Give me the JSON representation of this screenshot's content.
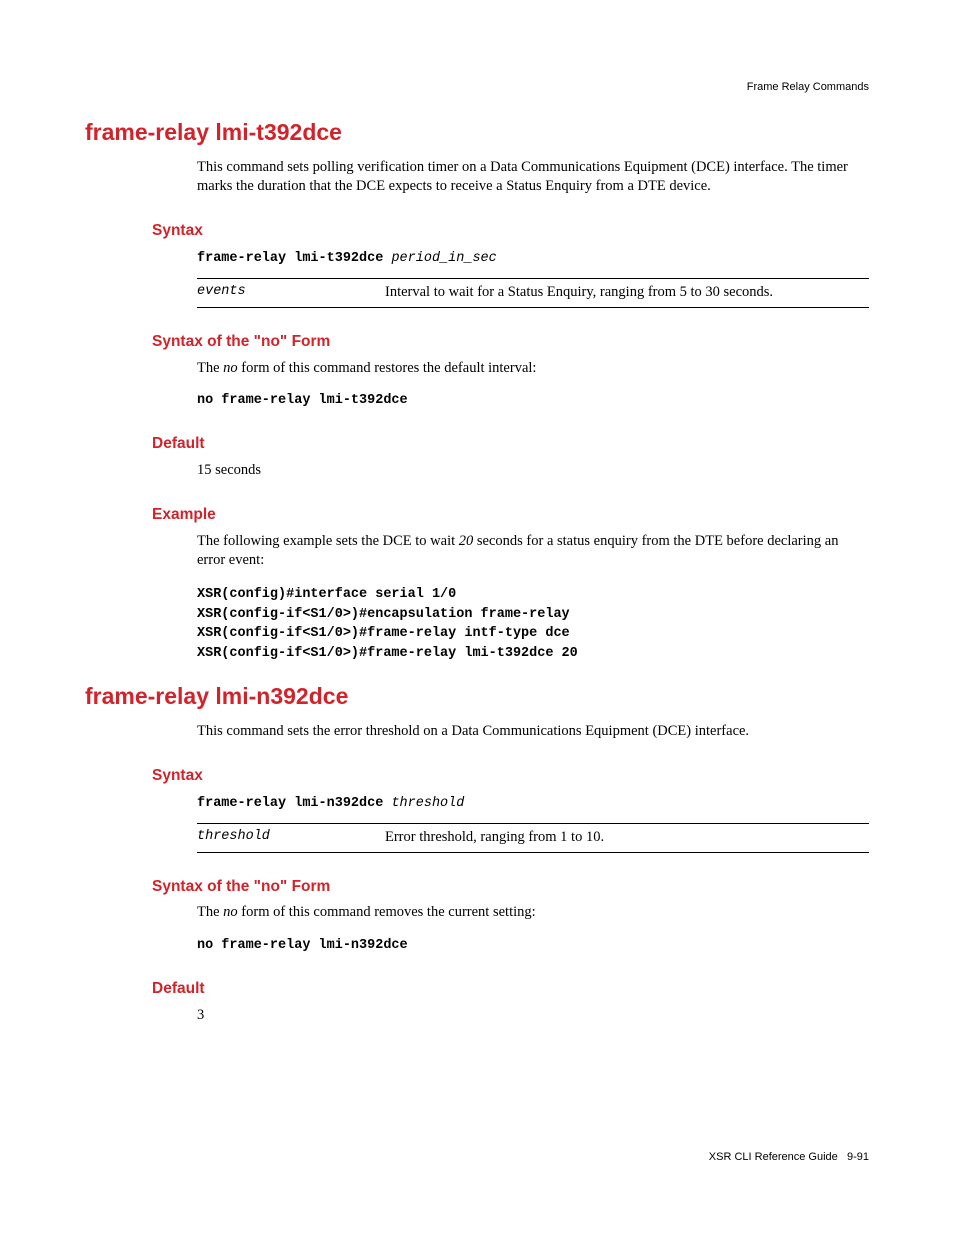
{
  "header": {
    "right": "Frame Relay Commands"
  },
  "sections": [
    {
      "title": "frame-relay lmi-t392dce",
      "intro": "This command sets polling verification timer on a Data Communications Equipment (DCE) interface. The timer marks the duration that the DCE expects to receive a Status Enquiry from a DTE device.",
      "syntax": {
        "heading": "Syntax",
        "cmd": "frame-relay lmi-t392dce ",
        "arg": "period_in_sec",
        "param_key": "events",
        "param_desc": "Interval to wait for a Status Enquiry, ranging from 5 to 30 seconds."
      },
      "noform": {
        "heading": "Syntax of the \"no\" Form",
        "text_pre": "The ",
        "text_em": "no",
        "text_post": " form of this command restores the default interval:",
        "cmd": "no frame-relay lmi-t392dce"
      },
      "default": {
        "heading": "Default",
        "value": "15 seconds"
      },
      "example": {
        "heading": "Example",
        "text_pre": "The following example sets the DCE to wait ",
        "text_em": "20",
        "text_post": " seconds for a status enquiry from the DTE before declaring an error event:",
        "code": "XSR(config)#interface serial 1/0\nXSR(config-if<S1/0>)#encapsulation frame-relay\nXSR(config-if<S1/0>)#frame-relay intf-type dce\nXSR(config-if<S1/0>)#frame-relay lmi-t392dce 20"
      }
    },
    {
      "title": "frame-relay lmi-n392dce",
      "intro": "This command sets the error threshold on a Data Communications Equipment (DCE) interface.",
      "syntax": {
        "heading": "Syntax",
        "cmd": "frame-relay lmi-n392dce ",
        "arg": "threshold",
        "param_key": "threshold",
        "param_desc": "Error threshold, ranging from 1 to 10."
      },
      "noform": {
        "heading": "Syntax of the \"no\" Form",
        "text_pre": "The ",
        "text_em": "no",
        "text_post": " form of this command removes the current setting:",
        "cmd": "no frame-relay lmi-n392dce"
      },
      "default": {
        "heading": "Default",
        "value": "3"
      }
    }
  ],
  "footer": {
    "left": "XSR CLI Reference Guide",
    "right": "9-91"
  }
}
